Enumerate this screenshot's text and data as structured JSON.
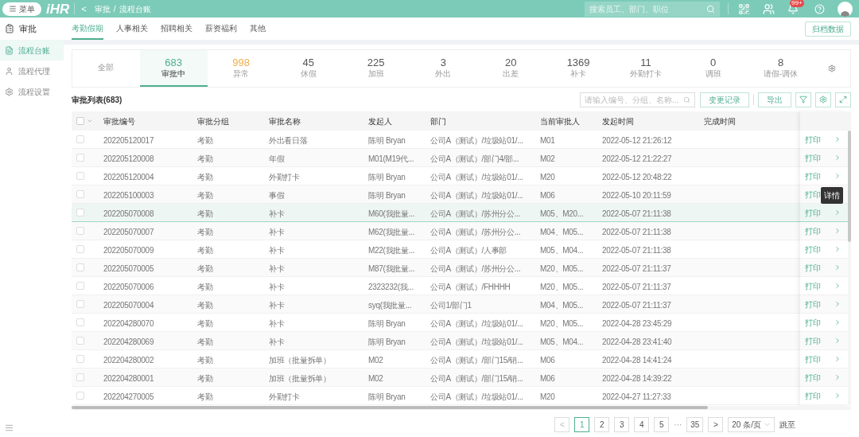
{
  "header": {
    "menu_button": "菜单",
    "logo": "iHR",
    "back": "<",
    "breadcrumb": [
      "审批",
      "流程台账"
    ],
    "breadcrumb_separator": "/",
    "search": {
      "placeholder": "搜索员工、部门、职位"
    },
    "badge": "99+"
  },
  "sidebar": {
    "title": "审批",
    "items": [
      {
        "label": "流程台账",
        "selected": true
      },
      {
        "label": "流程代理",
        "selected": false
      },
      {
        "label": "流程设置",
        "selected": false
      }
    ]
  },
  "tabs": [
    {
      "label": "考勤假期",
      "selected": true
    },
    {
      "label": "人事相关",
      "selected": false
    },
    {
      "label": "招聘相关",
      "selected": false
    },
    {
      "label": "薪资福利",
      "selected": false
    },
    {
      "label": "其他",
      "selected": false
    }
  ],
  "archive_button": "归档数据",
  "stats": [
    {
      "label": "全部",
      "selected": false
    },
    {
      "value": "683",
      "label": "审批中",
      "selected": true,
      "color": "#4fae91"
    },
    {
      "value": "998",
      "label": "异常",
      "selected": false,
      "color": "#f0ae4a"
    },
    {
      "value": "45",
      "label": "休假",
      "selected": false
    },
    {
      "value": "225",
      "label": "加班",
      "selected": false
    },
    {
      "value": "3",
      "label": "外出",
      "selected": false
    },
    {
      "value": "20",
      "label": "出差",
      "selected": false
    },
    {
      "value": "1369",
      "label": "补卡",
      "selected": false
    },
    {
      "value": "11",
      "label": "外勤打卡",
      "selected": false
    },
    {
      "value": "0",
      "label": "调班",
      "selected": false
    },
    {
      "value": "8",
      "label": "请假-调休",
      "selected": false
    }
  ],
  "list_title": "审批列表(683)",
  "toolbar": {
    "search": {
      "placeholder": "请输入编号、分组、名称..."
    },
    "change_log": "变更记录",
    "export": "导出"
  },
  "table": {
    "header_checked": false,
    "columns": [
      "审批编号",
      "审批分组",
      "审批名称",
      "发起人",
      "部门",
      "当前审批人",
      "发起时间",
      "完成时间"
    ],
    "rows": [
      {
        "checked": false,
        "highlighted": false,
        "cells": [
          "202205120017",
          "考勤",
          "外出看日落",
          "陈明 Bryan",
          "公司A（测试）/垃圾站01/...",
          "M01",
          "2022-05-12 21:26:12",
          ""
        ],
        "action": "打印"
      },
      {
        "checked": false,
        "highlighted": false,
        "cells": [
          "202205120008",
          "考勤",
          "年假",
          "M01(M19代...",
          "公司A（测试）/部门4/部...",
          "M02",
          "2022-05-12 21:22:27",
          ""
        ],
        "action": "打印"
      },
      {
        "checked": false,
        "highlighted": false,
        "cells": [
          "202205120004",
          "考勤",
          "外勤打卡",
          "陈明 Bryan",
          "公司A（测试）/垃圾站01/...",
          "M20",
          "2022-05-12 20:48:22",
          ""
        ],
        "action": "打印"
      },
      {
        "checked": false,
        "highlighted": false,
        "cells": [
          "202205100003",
          "考勤",
          "事假",
          "陈明 Bryan",
          "公司A（测试）/垃圾站01/...",
          "M06",
          "2022-05-10 20:11:59",
          ""
        ],
        "action": "打印",
        "tooltip": "详情"
      },
      {
        "checked": false,
        "highlighted": true,
        "cells": [
          "202205070008",
          "考勤",
          "补卡",
          "M60(我批量...",
          "公司A（测试）/苏州分公...",
          "M05、M20...",
          "2022-05-07 21:11:38",
          ""
        ],
        "action": "打印"
      },
      {
        "checked": false,
        "highlighted": false,
        "cells": [
          "202205070007",
          "考勤",
          "补卡",
          "M62(我批量...",
          "公司A（测试）/苏州分公...",
          "M04、M05...",
          "2022-05-07 21:11:38",
          ""
        ],
        "action": "打印"
      },
      {
        "checked": false,
        "highlighted": false,
        "cells": [
          "202205070009",
          "考勤",
          "补卡",
          "M22(我批量...",
          "公司A（测试）/人事部",
          "M05、M04...",
          "2022-05-07 21:11:38",
          ""
        ],
        "action": "打印"
      },
      {
        "checked": false,
        "highlighted": false,
        "cells": [
          "202205070005",
          "考勤",
          "补卡",
          "M87(我批量...",
          "公司A（测试）/苏州分公...",
          "M20、M05...",
          "2022-05-07 21:11:37",
          ""
        ],
        "action": "打印"
      },
      {
        "checked": false,
        "highlighted": false,
        "cells": [
          "202205070006",
          "考勤",
          "补卡",
          "2323232(我...",
          "公司A（测试）/FHHHH",
          "M20、M05...",
          "2022-05-07 21:11:37",
          ""
        ],
        "action": "打印"
      },
      {
        "checked": false,
        "highlighted": false,
        "cells": [
          "202205070004",
          "考勤",
          "补卡",
          "syq(我批量...",
          "公司1/部门1",
          "M04、M05...",
          "2022-05-07 21:11:37",
          ""
        ],
        "action": "打印"
      },
      {
        "checked": false,
        "highlighted": false,
        "cells": [
          "202204280070",
          "考勤",
          "补卡",
          "陈明 Bryan",
          "公司A（测试）/垃圾站01/...",
          "M20、M05...",
          "2022-04-28 23:45:29",
          ""
        ],
        "action": "打印"
      },
      {
        "checked": false,
        "highlighted": false,
        "cells": [
          "202204280069",
          "考勤",
          "补卡",
          "陈明 Bryan",
          "公司A（测试）/垃圾站01/...",
          "M05、M04...",
          "2022-04-28 23:41:40",
          ""
        ],
        "action": "打印"
      },
      {
        "checked": false,
        "highlighted": false,
        "cells": [
          "202204280002",
          "考勤",
          "加班（批量拆单）",
          "M02",
          "公司A（测试）/部门15/销...",
          "M06",
          "2022-04-28 14:41:24",
          ""
        ],
        "action": "打印"
      },
      {
        "checked": false,
        "highlighted": false,
        "cells": [
          "202204280001",
          "考勤",
          "加班（批量拆单）",
          "M02",
          "公司A（测试）/部门15/销...",
          "M06",
          "2022-04-28 14:39:22",
          ""
        ],
        "action": "打印"
      },
      {
        "checked": false,
        "highlighted": false,
        "cells": [
          "202204270005",
          "考勤",
          "外勤打卡",
          "陈明 Bryan",
          "公司A（测试）/垃圾站01/...",
          "M20",
          "2022-04-27 11:27:33",
          ""
        ],
        "action": "打印"
      }
    ]
  },
  "pagination": {
    "prev": "<",
    "pages": [
      {
        "label": "1",
        "selected": true
      },
      {
        "label": "2",
        "selected": false
      },
      {
        "label": "3",
        "selected": false
      },
      {
        "label": "4",
        "selected": false
      },
      {
        "label": "5",
        "selected": false
      }
    ],
    "ellipsis": "···",
    "last": "35",
    "next": ">",
    "page_size": "20 条/页",
    "jump": "跳至"
  }
}
